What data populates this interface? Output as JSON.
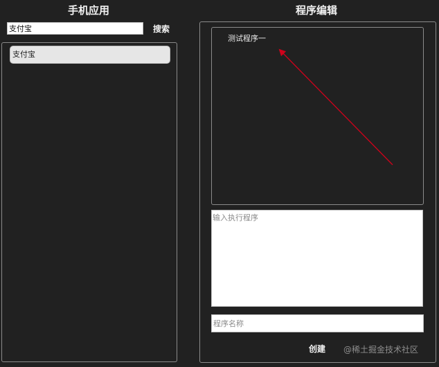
{
  "left_panel": {
    "title": "手机应用",
    "search": {
      "value": "支付宝",
      "button_label": "搜索"
    },
    "apps": [
      {
        "name": "支付宝"
      }
    ]
  },
  "right_panel": {
    "title": "程序编辑",
    "programs": [
      {
        "name": "测试程序一"
      }
    ],
    "code_placeholder": "输入执行程序",
    "name_placeholder": "程序名称",
    "create_label": "创建"
  },
  "watermark": "@稀土掘金技术社区",
  "colors": {
    "background": "#212121",
    "border": "#8c8c8c",
    "annotation_arrow": "#d0021b"
  }
}
